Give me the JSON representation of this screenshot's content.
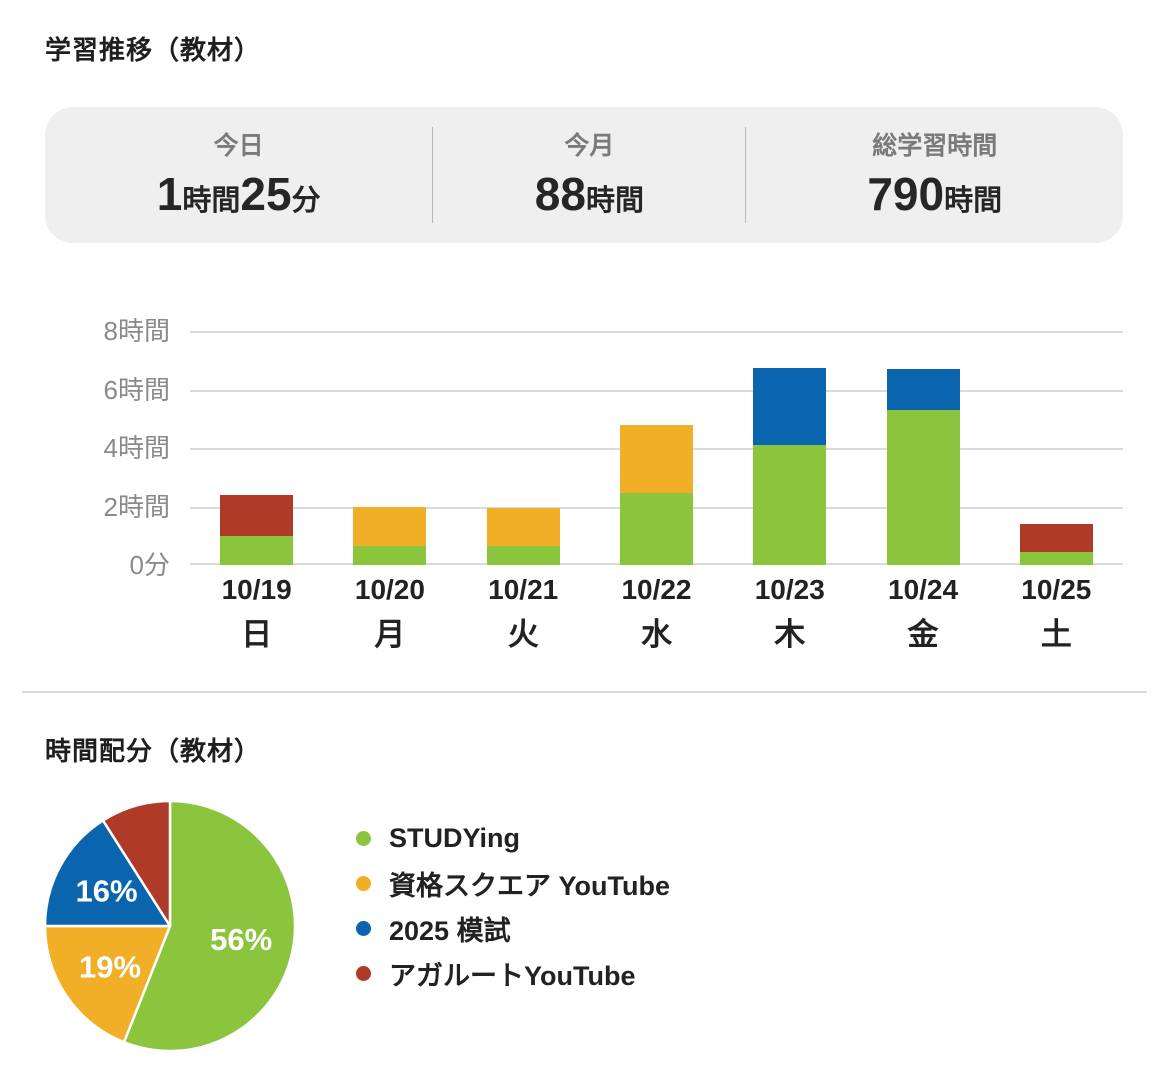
{
  "sections": {
    "progress_title": "学習推移（教材）",
    "allocation_title": "時間配分（教材）"
  },
  "stats": {
    "items": [
      {
        "label": "今日",
        "value": "1時間25分"
      },
      {
        "label": "今月",
        "value": "88時間"
      },
      {
        "label": "総学習時間",
        "value": "790時間"
      }
    ]
  },
  "colors": {
    "studying_green": "#8bc53e",
    "shikaku_yellow": "#f0af27",
    "moshi_blue": "#0a65ae",
    "agaroot_red": "#ae3a27",
    "gridline": "#dadada",
    "card_bg": "#efefef"
  },
  "chart_data": [
    {
      "type": "bar",
      "stacked": true,
      "title": "学習推移（教材）",
      "categories": [
        "10/19",
        "10/20",
        "10/21",
        "10/22",
        "10/23",
        "10/24",
        "10/25"
      ],
      "weekdays": [
        "日",
        "月",
        "火",
        "水",
        "木",
        "金",
        "土"
      ],
      "series": [
        {
          "name": "STUDYing",
          "color": "#8bc53e",
          "values": [
            1.0,
            0.65,
            0.65,
            2.45,
            4.1,
            5.3,
            0.45
          ]
        },
        {
          "name": "資格スクエア YouTube",
          "color": "#f0af27",
          "values": [
            0,
            1.35,
            1.3,
            2.35,
            0,
            0,
            0
          ]
        },
        {
          "name": "2025 模試",
          "color": "#0a65ae",
          "values": [
            0,
            0,
            0,
            0,
            2.65,
            1.4,
            0
          ]
        },
        {
          "name": "アガルートYouTube",
          "color": "#ae3a27",
          "values": [
            1.4,
            0,
            0,
            0,
            0,
            0,
            0.95
          ]
        }
      ],
      "ylim": [
        0,
        8
      ],
      "y_ticks": [
        {
          "value": 0,
          "label": "0分"
        },
        {
          "value": 2,
          "label": "2時間"
        },
        {
          "value": 4,
          "label": "4時間"
        },
        {
          "value": 6,
          "label": "6時間"
        },
        {
          "value": 8,
          "label": "8時間"
        }
      ],
      "grid": true,
      "legend_position": "none"
    },
    {
      "type": "pie",
      "title": "時間配分（教材）",
      "start_angle_deg": 0,
      "clockwise": true,
      "legend_position": "right",
      "slices": [
        {
          "label": "STUDYing",
          "value": 56,
          "display": "56%",
          "color": "#8bc53e"
        },
        {
          "label": "資格スクエア YouTube",
          "value": 19,
          "display": "19%",
          "color": "#f0af27"
        },
        {
          "label": "2025 模試",
          "value": 16,
          "display": "16%",
          "color": "#0a65ae"
        },
        {
          "label": "アガルートYouTube",
          "value": 9,
          "display": "",
          "color": "#ae3a27"
        }
      ]
    }
  ]
}
